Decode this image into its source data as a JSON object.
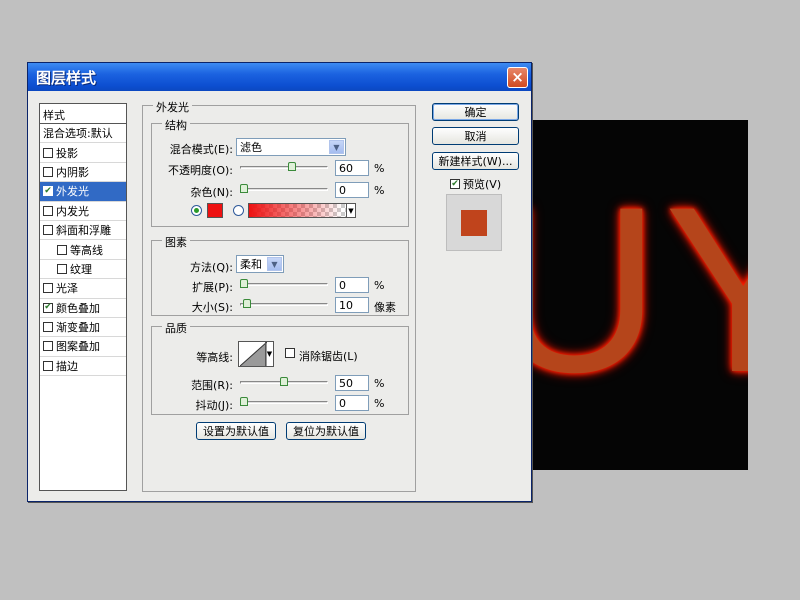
{
  "canvas": {
    "text": "UY",
    "text_color": "#b5451b",
    "glow_color": "#ff2000",
    "background": "#050505"
  },
  "dialog": {
    "title": "图层样式",
    "close_icon": "×"
  },
  "style_list": {
    "header": "样式",
    "blend_options": "混合选项:默认",
    "items": [
      {
        "label": "投影",
        "checked": false
      },
      {
        "label": "内阴影",
        "checked": false
      },
      {
        "label": "外发光",
        "checked": true,
        "selected": true
      },
      {
        "label": "内发光",
        "checked": false
      },
      {
        "label": "斜面和浮雕",
        "checked": false
      },
      {
        "label": "等高线",
        "checked": false,
        "indent": true
      },
      {
        "label": "纹理",
        "checked": false,
        "indent": true
      },
      {
        "label": "光泽",
        "checked": false
      },
      {
        "label": "颜色叠加",
        "checked": true
      },
      {
        "label": "渐变叠加",
        "checked": false
      },
      {
        "label": "图案叠加",
        "checked": false
      },
      {
        "label": "描边",
        "checked": false
      }
    ]
  },
  "outer_glow": {
    "title": "外发光",
    "structure": {
      "title": "结构",
      "blend_mode_label": "混合模式(E):",
      "blend_mode_value": "滤色",
      "opacity_label": "不透明度(O):",
      "opacity_value": "60",
      "opacity_unit": "%",
      "opacity_level": 0.6,
      "noise_label": "杂色(N):",
      "noise_value": "0",
      "noise_unit": "%",
      "noise_level": 0,
      "glow_color": "#ee1111",
      "gradient_start": "#ee1111"
    },
    "elements": {
      "title": "图素",
      "technique_label": "方法(Q):",
      "technique_value": "柔和",
      "spread_label": "扩展(P):",
      "spread_value": "0",
      "spread_unit": "%",
      "spread_level": 0,
      "size_label": "大小(S):",
      "size_value": "10",
      "size_unit": "像素",
      "size_level": 0.04
    },
    "quality": {
      "title": "品质",
      "contour_label": "等高线:",
      "antialias_label": "消除锯齿(L)",
      "antialias_checked": false,
      "range_label": "范围(R):",
      "range_value": "50",
      "range_unit": "%",
      "range_level": 0.5,
      "jitter_label": "抖动(J):",
      "jitter_value": "0",
      "jitter_unit": "%",
      "jitter_level": 0
    },
    "make_default": "设置为默认值",
    "reset_default": "复位为默认值"
  },
  "buttons": {
    "ok": "确定",
    "cancel": "取消",
    "new_style": "新建样式(W)...",
    "preview_label": "预览(V)",
    "preview_checked": true
  },
  "preview_swatch_color": "#c0441c"
}
